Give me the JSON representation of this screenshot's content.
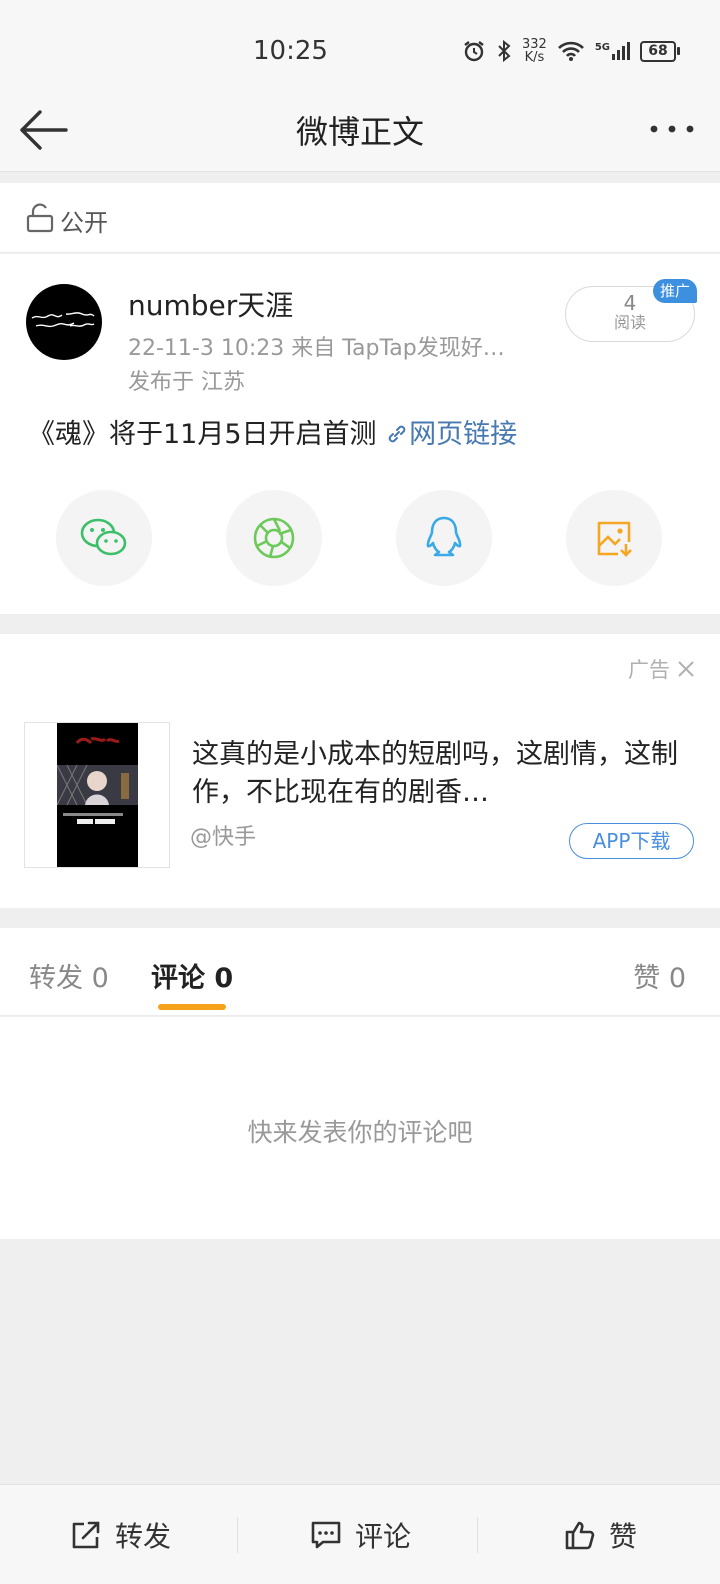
{
  "status_bar": {
    "time": "10:25",
    "net_speed_value": "332",
    "net_speed_unit": "K/s",
    "network_type": "5G",
    "battery": "68",
    "icons": [
      "alarm-icon",
      "bluetooth-icon",
      "wifi-icon",
      "signal-icon",
      "battery-icon"
    ]
  },
  "nav": {
    "title": "微博正文",
    "back_icon": "arrow-left-icon",
    "more_icon": "more-dots-icon"
  },
  "visibility": {
    "label": "公开",
    "icon": "unlock-icon"
  },
  "post": {
    "author": "number天涯",
    "meta_line": "22-11-3 10:23   来自 TapTap发现好…",
    "location_line": "发布于 江苏",
    "read_count": "4",
    "read_label": "阅读",
    "promo_badge": "推广",
    "text": "《魂》将于11月5日开启首测 ",
    "link_text": "网页链接",
    "link_icon": "link-icon"
  },
  "share": [
    {
      "name": "wechat",
      "icon": "wechat-icon",
      "color": "#3dbf6a"
    },
    {
      "name": "moments",
      "icon": "moments-icon",
      "color": "#6cc95a"
    },
    {
      "name": "qq",
      "icon": "qq-icon",
      "color": "#3aa9e6"
    },
    {
      "name": "save-image",
      "icon": "save-image-icon",
      "color": "#f5a623"
    }
  ],
  "ad": {
    "label": "广告",
    "title": "这真的是小成本的短剧吗，这剧情，这制作，不比现在有的剧香…",
    "source": "@快手",
    "button": "APP下载"
  },
  "tabs": {
    "repost": "转发 0",
    "comment": "评论 0",
    "like": "赞 0",
    "active": "comment",
    "accent": "#f7a21b"
  },
  "comments": {
    "empty_message": "快来发表你的评论吧"
  },
  "bottom_bar": {
    "repost": "转发",
    "comment": "评论",
    "like": "赞"
  },
  "colors": {
    "link": "#4778b0",
    "badge": "#3d8fe0",
    "app_button": "#4a8ee0"
  }
}
